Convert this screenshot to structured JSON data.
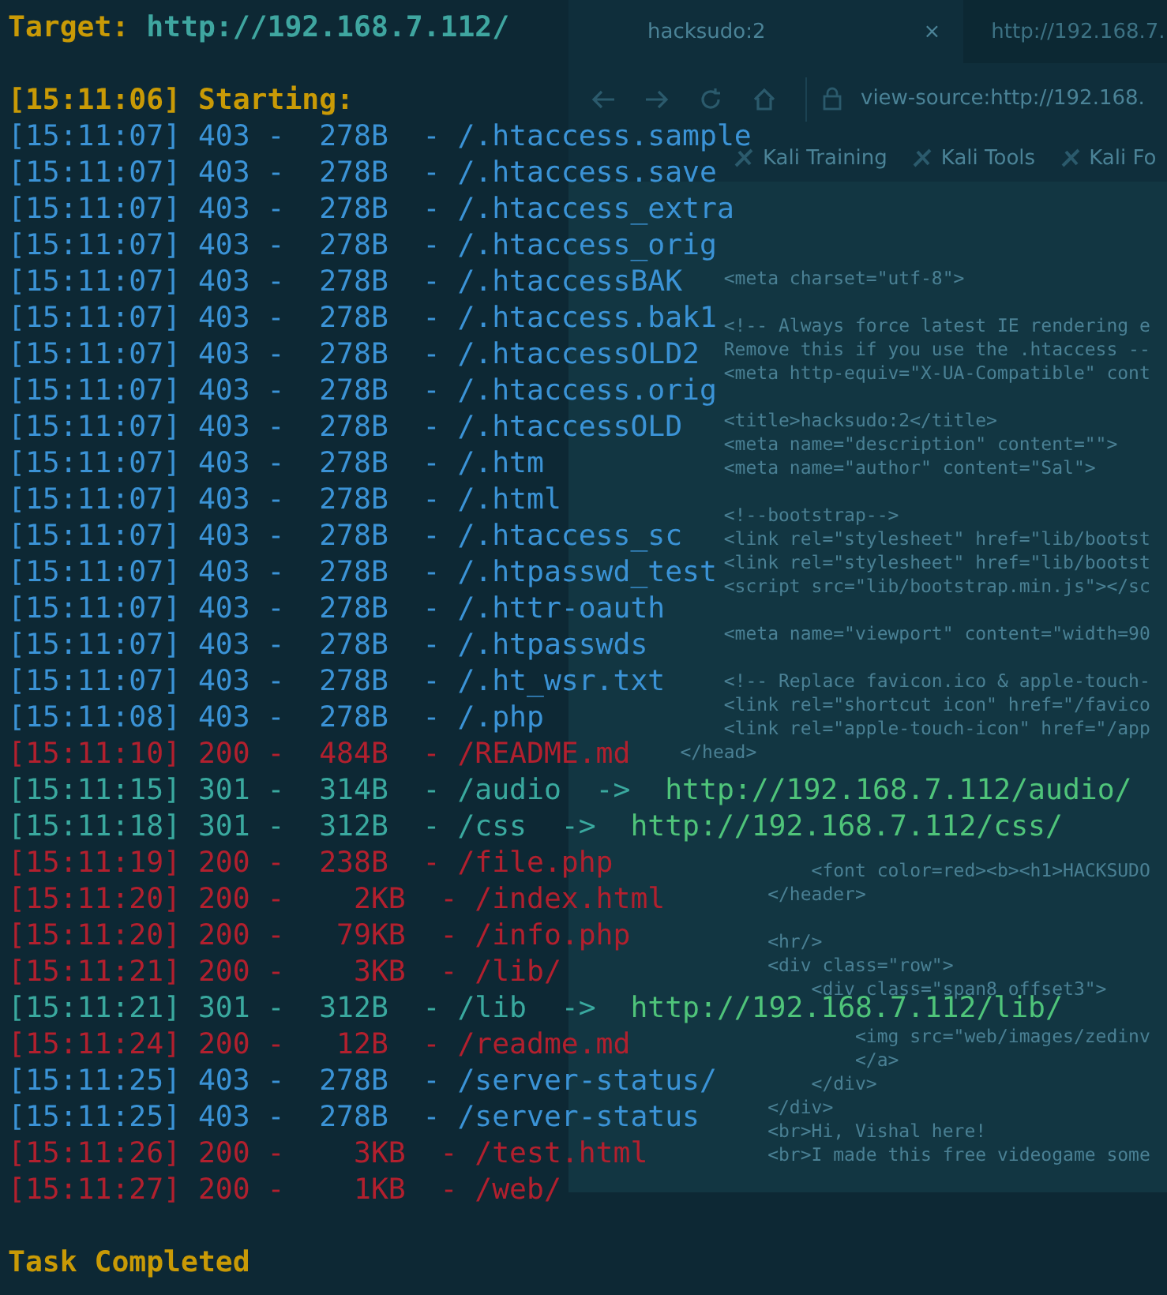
{
  "browser": {
    "tabs": [
      {
        "title": "hacksudo:2",
        "close": "×",
        "selected": true
      },
      {
        "title": "http://192.168.7.",
        "selected": false
      }
    ],
    "address": "view-source:http://192.168.",
    "bookmarks": [
      "Kali Training",
      "Kali Tools",
      "Kali Fo"
    ],
    "source_blocks": [
      [
        "        <meta charset=\"utf-8\">"
      ],
      [
        "        <!-- Always force latest IE rendering e",
        "        Remove this if you use the .htaccess --",
        "        <meta http-equiv=\"X-UA-Compatible\" cont"
      ],
      [
        "        <title>hacksudo:2</title>",
        "        <meta name=\"description\" content=\"\">",
        "        <meta name=\"author\" content=\"Sal\">"
      ],
      [
        "        <!--bootstrap-->",
        "        <link rel=\"stylesheet\" href=\"lib/bootst",
        "        <link rel=\"stylesheet\" href=\"lib/bootst",
        "        <script src=\"lib/bootstrap.min.js\"></sc"
      ],
      [
        "        <meta name=\"viewport\" content=\"width=90"
      ],
      [
        "        <!-- Replace favicon.ico & apple-touch-",
        "        <link rel=\"shortcut icon\" href=\"/favico",
        "        <link rel=\"apple-touch-icon\" href=\"/app",
        "    </head>"
      ],
      [
        "                <font color=red><b><h1>HACKSUDO",
        "            </header>"
      ],
      [
        "            <hr/>",
        "            <div class=\"row\">",
        "                <div class=\"span8 offset3\">"
      ],
      [
        "                    <img src=\"web/images/zedinv",
        "                    </a>",
        "                </div>",
        "            </div>",
        "            <br>Hi, Vishal here!",
        "            <br>I made this free videogame some"
      ]
    ]
  },
  "terminal": {
    "target_label": "Target:",
    "target_url": "http://192.168.7.112/",
    "start": "[15:11:06] Starting:",
    "entries": [
      {
        "text": "[15:11:07] 403 -  278B  - /.htaccess.sample",
        "kind": "forbidden"
      },
      {
        "text": "[15:11:07] 403 -  278B  - /.htaccess.save",
        "kind": "forbidden"
      },
      {
        "text": "[15:11:07] 403 -  278B  - /.htaccess_extra",
        "kind": "forbidden"
      },
      {
        "text": "[15:11:07] 403 -  278B  - /.htaccess_orig",
        "kind": "forbidden"
      },
      {
        "text": "[15:11:07] 403 -  278B  - /.htaccessBAK",
        "kind": "forbidden"
      },
      {
        "text": "[15:11:07] 403 -  278B  - /.htaccess.bak1",
        "kind": "forbidden"
      },
      {
        "text": "[15:11:07] 403 -  278B  - /.htaccessOLD2",
        "kind": "forbidden"
      },
      {
        "text": "[15:11:07] 403 -  278B  - /.htaccess.orig",
        "kind": "forbidden"
      },
      {
        "text": "[15:11:07] 403 -  278B  - /.htaccessOLD",
        "kind": "forbidden"
      },
      {
        "text": "[15:11:07] 403 -  278B  - /.htm",
        "kind": "forbidden"
      },
      {
        "text": "[15:11:07] 403 -  278B  - /.html",
        "kind": "forbidden"
      },
      {
        "text": "[15:11:07] 403 -  278B  - /.htaccess_sc",
        "kind": "forbidden"
      },
      {
        "text": "[15:11:07] 403 -  278B  - /.htpasswd_test",
        "kind": "forbidden"
      },
      {
        "text": "[15:11:07] 403 -  278B  - /.httr-oauth",
        "kind": "forbidden"
      },
      {
        "text": "[15:11:07] 403 -  278B  - /.htpasswds",
        "kind": "forbidden"
      },
      {
        "text": "[15:11:07] 403 -  278B  - /.ht_wsr.txt",
        "kind": "forbidden"
      },
      {
        "text": "[15:11:08] 403 -  278B  - /.php",
        "kind": "forbidden"
      },
      {
        "text": "[15:11:10] 200 -  484B  - /README.md",
        "kind": "ok"
      },
      {
        "text": "[15:11:15] 301 -  314B  - /audio  ->",
        "redirect": "http://192.168.7.112/audio/",
        "kind": "redirect"
      },
      {
        "text": "[15:11:18] 301 -  312B  - /css  ->",
        "redirect": "http://192.168.7.112/css/",
        "kind": "redirect"
      },
      {
        "text": "[15:11:19] 200 -  238B  - /file.php",
        "kind": "ok"
      },
      {
        "text": "[15:11:20] 200 -    2KB  - /index.html",
        "kind": "ok"
      },
      {
        "text": "[15:11:20] 200 -   79KB  - /info.php",
        "kind": "ok"
      },
      {
        "text": "[15:11:21] 200 -    3KB  - /lib/",
        "kind": "ok"
      },
      {
        "text": "[15:11:21] 301 -  312B  - /lib  ->",
        "redirect": "http://192.168.7.112/lib/",
        "kind": "redirect"
      },
      {
        "text": "[15:11:24] 200 -   12B  - /readme.md",
        "kind": "ok"
      },
      {
        "text": "[15:11:25] 403 -  278B  - /server-status/",
        "kind": "forbidden"
      },
      {
        "text": "[15:11:25] 403 -  278B  - /server-status",
        "kind": "forbidden"
      },
      {
        "text": "[15:11:26] 200 -    3KB  - /test.html",
        "kind": "ok"
      },
      {
        "text": "[15:11:27] 200 -    1KB  - /web/",
        "kind": "ok"
      }
    ],
    "done": "Task Completed"
  }
}
